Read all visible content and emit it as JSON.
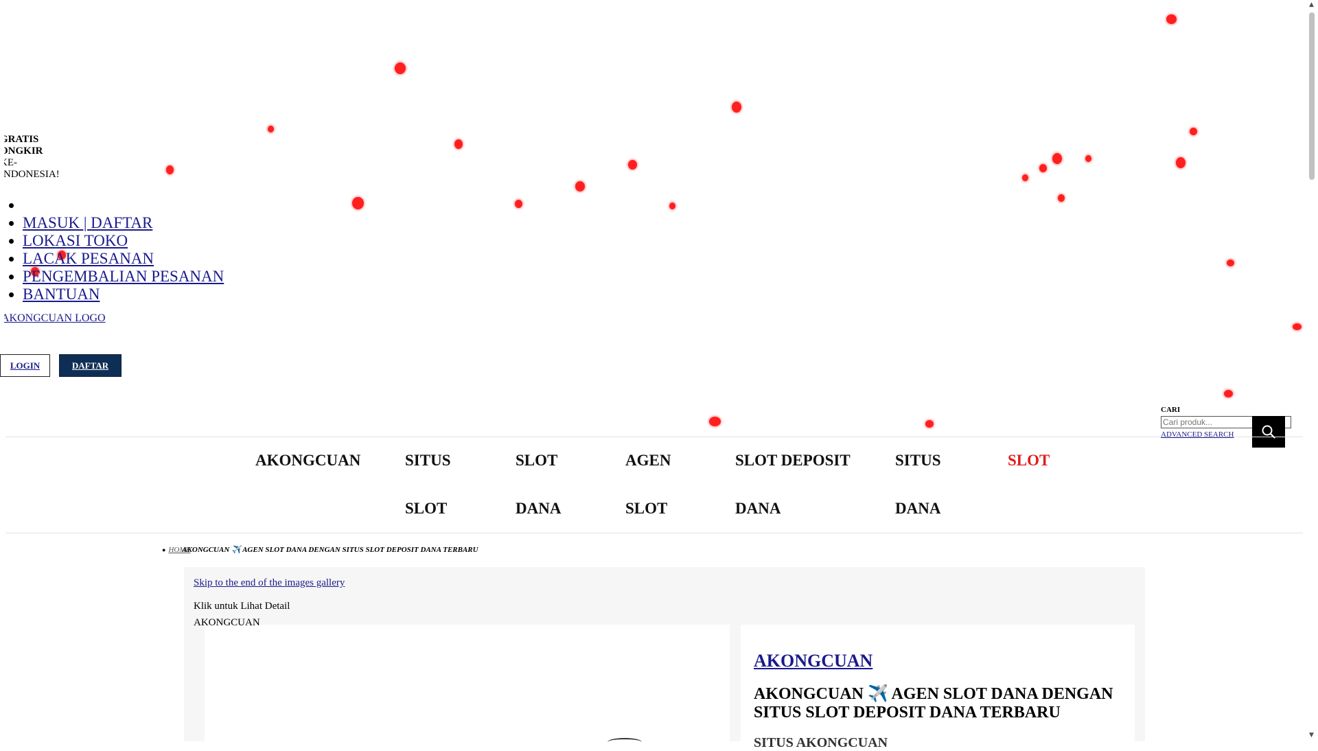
{
  "promo": {
    "line1": "GRATIS",
    "line2": "ONGKIR",
    "line3": "KE-",
    "line4": "INDONESIA!"
  },
  "top_nav": {
    "items": [
      {
        "label": ""
      },
      {
        "label": "MASUK | DAFTAR"
      },
      {
        "label": "LOKASI TOKO"
      },
      {
        "label": "LACAK PESANAN"
      },
      {
        "label": "PENGEMBALIAN PESANAN"
      },
      {
        "label": "BANTUAN"
      }
    ]
  },
  "header": {
    "logo_alt": "AKONGCUAN LOGO",
    "login_label": "LOGIN",
    "daftar_label": "DAFTAR"
  },
  "search": {
    "label": "CARI",
    "placeholder": "Cari produk...",
    "advanced_label": "ADVANCED SEARCH",
    "button_icon": "search-icon"
  },
  "main_nav": {
    "items": [
      {
        "line1": "AKONGCUAN",
        "line2": ""
      },
      {
        "line1": "SITUS",
        "line2": "SLOT"
      },
      {
        "line1": "SLOT",
        "line2": "DANA"
      },
      {
        "line1": "AGEN",
        "line2": "SLOT"
      },
      {
        "line1": "SLOT DEPOSIT",
        "line2": "DANA"
      },
      {
        "line1": "SITUS",
        "line2": "DANA"
      },
      {
        "line1": "SLOT",
        "line2": ""
      }
    ],
    "accent_color": "#e01e1e"
  },
  "breadcrumb": {
    "home": "HOME",
    "current": "AKONGCUAN ✈️ AGEN SLOT DANA DENGAN SITUS SLOT DEPOSIT DANA TERBARU"
  },
  "gallery": {
    "skip_label": "Skip to the end of the images gallery",
    "hint": "Klik untuk Lihat Detail",
    "image_alt": "AKONGCUAN"
  },
  "product": {
    "brand": "AKONGCUAN",
    "title": "AKONGCUAN ✈️ AGEN SLOT DANA DENGAN SITUS SLOT DEPOSIT DANA TERBARU",
    "subtitle": "SITUS AKONGCUAN"
  },
  "colors": {
    "dots": "#ff1f1f",
    "daftar_bg": "#0f2e55",
    "link": "#1a1a8c"
  }
}
